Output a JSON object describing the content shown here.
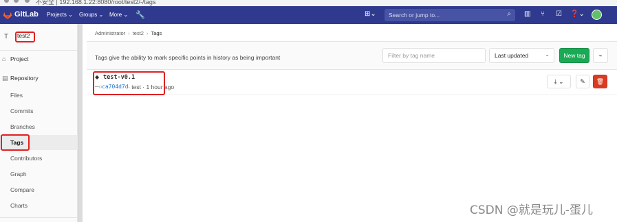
{
  "browser": {
    "url_fragment": "不安全 | 192.168.1.22:8080/root/test2/-/tags"
  },
  "topnav": {
    "brand": "GitLab",
    "menus": [
      "Projects ⌄",
      "Groups ⌄",
      "More ⌄"
    ],
    "search_placeholder": "Search or jump to..."
  },
  "sidebar": {
    "project_avatar": "T",
    "project_name": "test2",
    "items": [
      {
        "label": "Project"
      },
      {
        "label": "Repository"
      },
      {
        "label": "Files"
      },
      {
        "label": "Commits"
      },
      {
        "label": "Branches"
      },
      {
        "label": "Tags"
      },
      {
        "label": "Contributors"
      },
      {
        "label": "Graph"
      },
      {
        "label": "Compare"
      },
      {
        "label": "Charts"
      }
    ]
  },
  "breadcrumb": {
    "root": "Administrator",
    "project": "test2",
    "current": "Tags"
  },
  "info": {
    "text": "Tags give the ability to mark specific points in history as being important",
    "filter_placeholder": "Filter by tag name",
    "sort_value": "Last updated",
    "new_tag_label": "New tag"
  },
  "tags": [
    {
      "name": "test-v0.1",
      "sha": "ca704d7d",
      "meta": "· test · 1 hour ago"
    }
  ],
  "watermark": "CSDN @就是玩儿-蛋儿",
  "colors": {
    "nav": "#2f3a8f",
    "new_tag": "#1aaa55",
    "delete": "#db3b21",
    "annotation": "#e02020"
  }
}
